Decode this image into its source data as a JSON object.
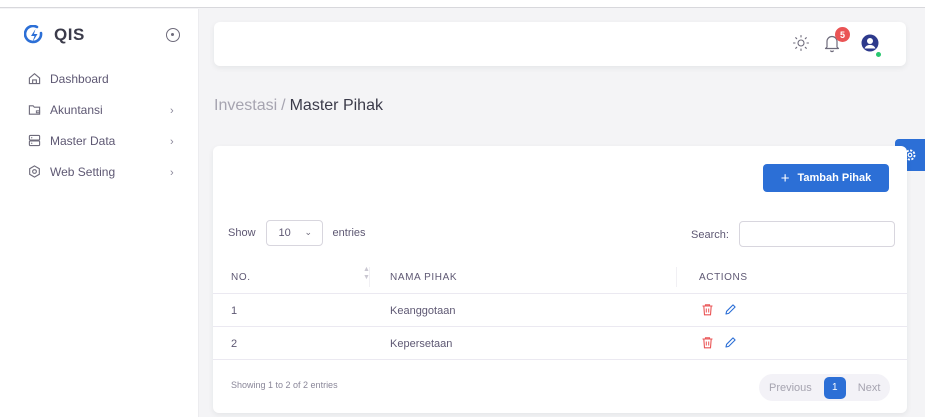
{
  "brand": {
    "name": "QIS"
  },
  "sidebar": {
    "items": [
      {
        "label": "Dashboard",
        "icon": "home-icon",
        "has_children": false
      },
      {
        "label": "Akuntansi",
        "icon": "folder-icon",
        "has_children": true
      },
      {
        "label": "Master Data",
        "icon": "server-icon",
        "has_children": true
      },
      {
        "label": "Web Setting",
        "icon": "settings-icon",
        "has_children": true
      }
    ]
  },
  "header": {
    "notification_count": "5"
  },
  "breadcrumb": {
    "parent": "Investasi",
    "separator": "/",
    "current": "Master Pihak"
  },
  "card": {
    "add_button": "Tambah Pihak",
    "show_label": "Show",
    "length_value": "10",
    "entries_label": "entries",
    "search_label": "Search:",
    "search_value": ""
  },
  "table": {
    "columns": [
      "NO.",
      "NAMA PIHAK",
      "ACTIONS"
    ],
    "rows": [
      {
        "no": "1",
        "nama": "Keanggotaan"
      },
      {
        "no": "2",
        "nama": "Kepersetaan"
      }
    ]
  },
  "footer": {
    "info": "Showing 1 to 2 of 2 entries",
    "previous": "Previous",
    "page": "1",
    "next": "Next"
  },
  "colors": {
    "primary": "#2c6fd6",
    "danger": "#ea5455",
    "success": "#28c76f",
    "edit": "#2c6fd6"
  }
}
